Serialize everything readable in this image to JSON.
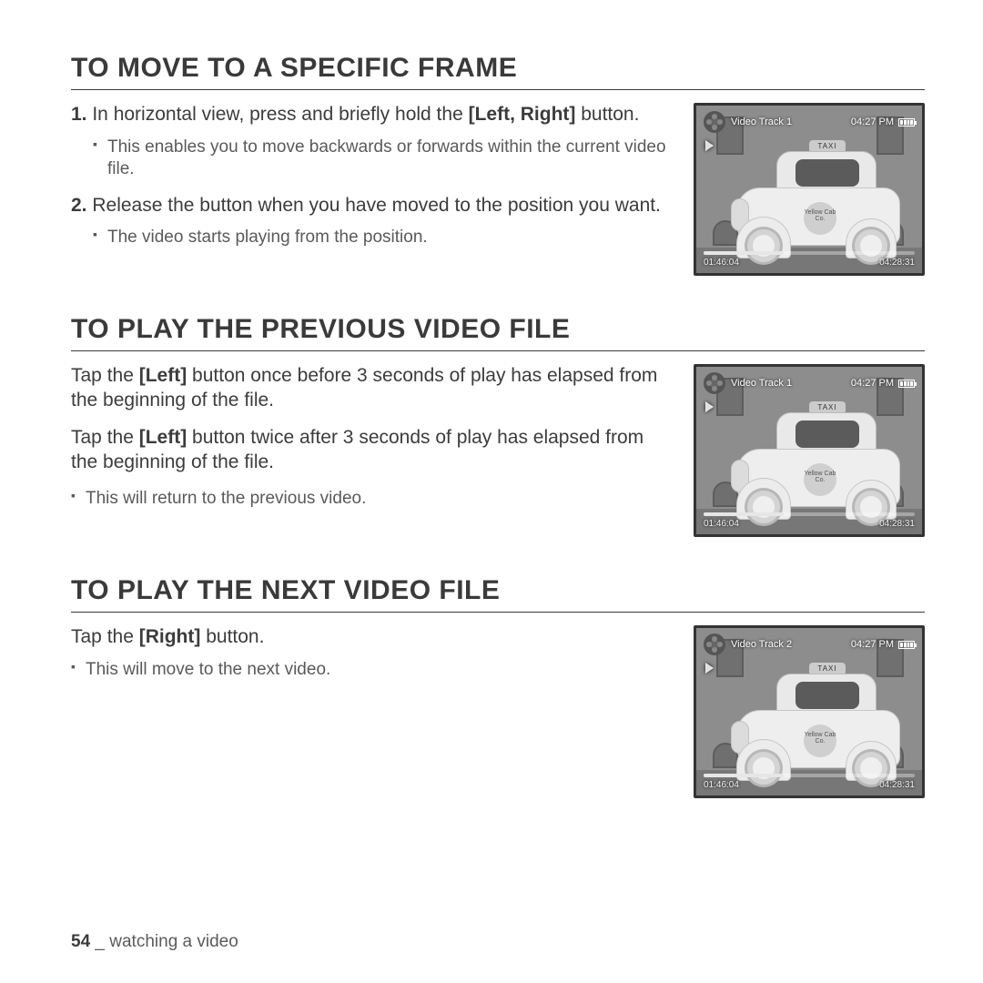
{
  "sections": {
    "move": {
      "title": "TO MOVE TO A SPECIFIC FRAME",
      "step1_num": "1.",
      "step1_a": " In horizontal view, press and briefly hold the ",
      "step1_bold": "[Left, Right]",
      "step1_b": " button.",
      "step1_sub": "This enables you to move backwards or forwards within the current video file.",
      "step2_num": "2.",
      "step2_a": " Release the button when you have moved to the position you want.",
      "step2_sub": "The video starts playing from the position."
    },
    "prev": {
      "title": "TO PLAY THE PREVIOUS VIDEO FILE",
      "p1_a": "Tap the ",
      "p1_bold": "[Left]",
      "p1_b": " button once before 3 seconds of play has elapsed from the beginning of the file.",
      "p2_a": "Tap the ",
      "p2_bold": "[Left]",
      "p2_b": " button twice after 3 seconds of play has elapsed from the beginning of the file.",
      "sub": "This will return to the previous video."
    },
    "next": {
      "title": "TO PLAY THE NEXT VIDEO FILE",
      "p1_a": "Tap the ",
      "p1_bold": "[Right]",
      "p1_b": " button.",
      "sub": "This will move to the next video."
    }
  },
  "shot": {
    "track1": "Video Track 1",
    "track2": "Video Track 2",
    "clock": "04:27 PM",
    "elapsed": "01:46:04",
    "total": "04:28:31",
    "taxi": "TAXI",
    "door": "Yellow Cab Co."
  },
  "footer": {
    "page": "54",
    "sep": " _ ",
    "label": "watching a video"
  }
}
